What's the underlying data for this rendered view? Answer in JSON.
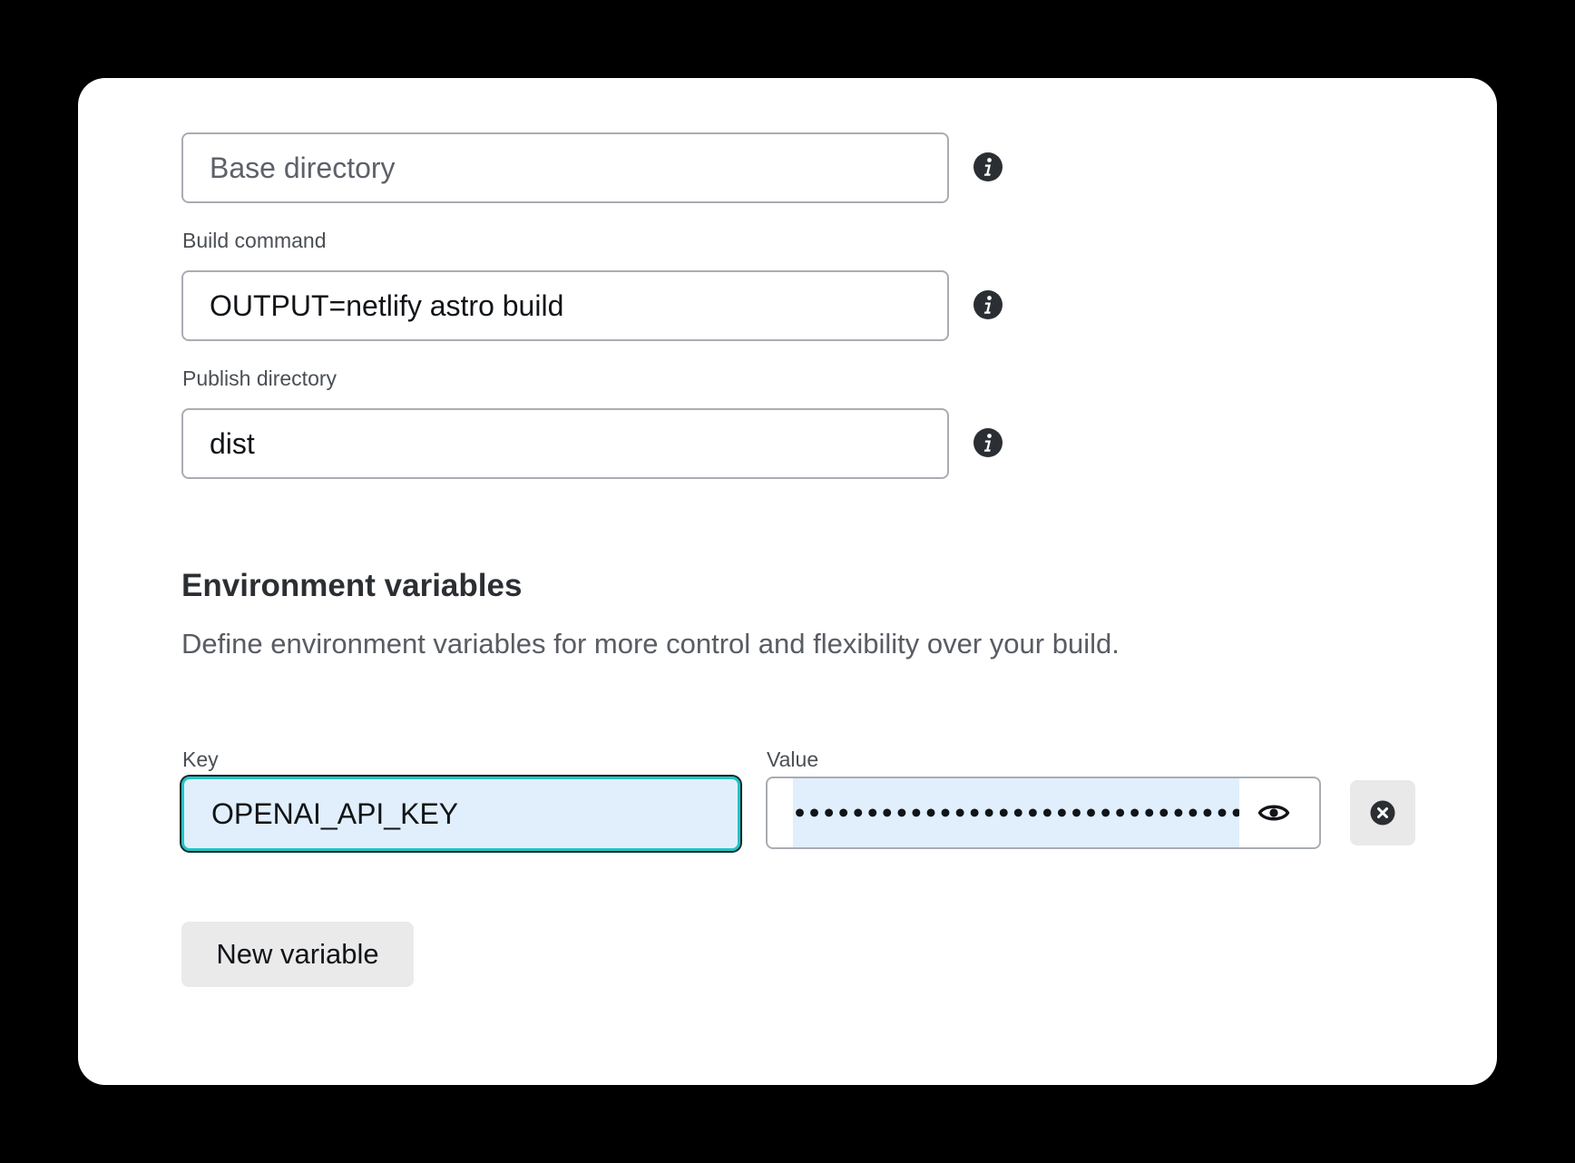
{
  "form": {
    "base_directory": {
      "placeholder": "Base directory",
      "value": ""
    },
    "build_command": {
      "label": "Build command",
      "value": "OUTPUT=netlify astro build"
    },
    "publish_directory": {
      "label": "Publish directory",
      "value": "dist"
    }
  },
  "env": {
    "title": "Environment variables",
    "description": "Define environment variables for more control and flexibility over your build.",
    "key_label": "Key",
    "value_label": "Value",
    "variables": [
      {
        "key": "OPENAI_API_KEY",
        "value_masked": "••••••••••••••••••••••••••••••••••"
      }
    ],
    "new_variable_label": "New variable"
  },
  "icons": {
    "info": "info-icon",
    "eye": "eye-icon",
    "remove": "close-circle-icon"
  },
  "colors": {
    "background": "#000000",
    "card": "#ffffff",
    "focus_ring": "#23c4c4",
    "autofill": "#e1effd",
    "icon": "#2b2f33",
    "button_bg": "#eaeaeb"
  }
}
